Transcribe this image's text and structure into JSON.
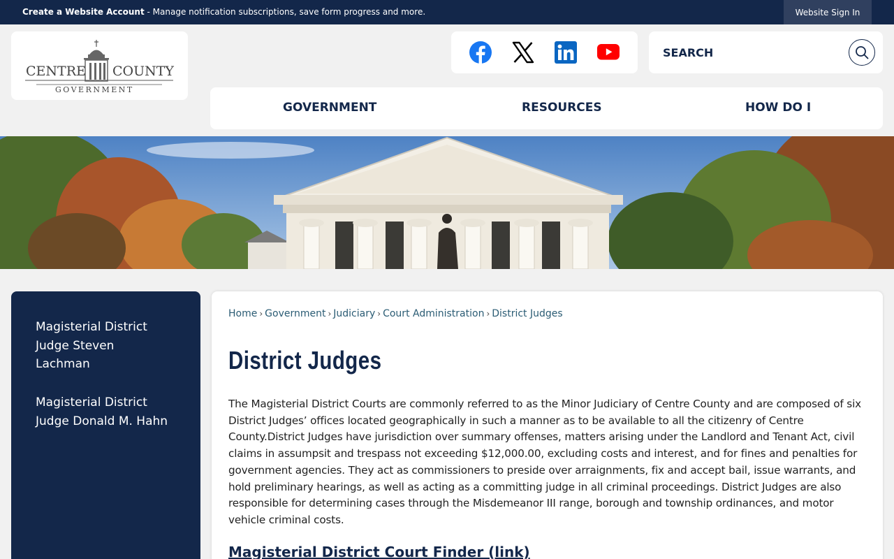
{
  "topbar": {
    "account_bold": "Create a Website Account",
    "account_rest": " - Manage notification subscriptions, save form progress and more.",
    "signin_label": "Website Sign In"
  },
  "logo": {
    "line1_left": "CENTRE",
    "line1_right": "COUNTY",
    "line2": "GOVERNMENT"
  },
  "social": [
    {
      "name": "facebook-icon",
      "color": "#1877f2"
    },
    {
      "name": "x-icon",
      "color": "#000000"
    },
    {
      "name": "linkedin-icon",
      "color": "#0a66c2"
    },
    {
      "name": "youtube-icon",
      "color": "#ff0000"
    }
  ],
  "search": {
    "placeholder": "SEARCH"
  },
  "nav": {
    "items": [
      "GOVERNMENT",
      "RESOURCES",
      "HOW DO I"
    ]
  },
  "sidebar": {
    "items": [
      "Magisterial District Judge Steven Lachman",
      "Magisterial District Judge Donald M. Hahn"
    ]
  },
  "breadcrumb": [
    "Home",
    "Government",
    "Judiciary",
    "Court Administration",
    "District Judges"
  ],
  "page": {
    "title": "District Judges",
    "body": "The Magisterial District Courts are commonly referred to as the Minor Judiciary of Centre County and are composed of six District Judges’ offices located geographically in such a manner as to be available to all the citizenry of Centre County.District Judges have jurisdiction over summary offenses, matters arising under the Landlord and Tenant Act, civil claims in assumpsit and trespass not exceeding $12,000.00, excluding costs and interest, and for fines and penalties for government agencies. They act as commissioners to preside over arraignments, fix and accept bail, issue warrants, and hold preliminary hearings, as well as acting as a committing judge in all criminal proceedings. District Judges are also responsible for determining cases through the Misdemeanor III range, borough and township ordinances, and motor vehicle criminal costs.",
    "finder_link": "Magisterial District Court Finder (link)"
  },
  "colors": {
    "navy": "#13274a",
    "link": "#2b5c74",
    "background": "#f1f1f1"
  }
}
